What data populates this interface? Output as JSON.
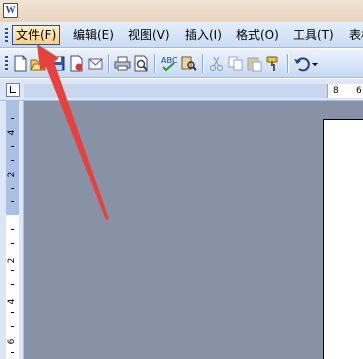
{
  "window": {
    "app_icon": "W"
  },
  "menubar": {
    "items": [
      {
        "label": "文件(F)",
        "active": true
      },
      {
        "label": "编辑(E)"
      },
      {
        "label": "视图(V)"
      },
      {
        "label": "插入(I)"
      },
      {
        "label": "格式(O)"
      },
      {
        "label": "工具(T)"
      },
      {
        "label": "表格"
      }
    ]
  },
  "toolbar": {
    "icons": [
      "new-document-icon",
      "open-folder-icon",
      "save-icon",
      "permission-icon",
      "email-icon",
      "print-icon",
      "print-preview-icon",
      "spelling-icon",
      "research-icon",
      "cut-icon",
      "copy-icon",
      "paste-icon",
      "format-painter-icon",
      "undo-icon",
      "dropdown-arrow-icon"
    ]
  },
  "ruler": {
    "horizontal_labels": [
      "8",
      "6"
    ],
    "vertical_labels": [
      "4",
      "2",
      "2",
      "4",
      "6"
    ]
  },
  "colors": {
    "menu_highlight": "#ffcf7a",
    "doc_background": "#8792a6",
    "arrow": "#e8403a"
  }
}
